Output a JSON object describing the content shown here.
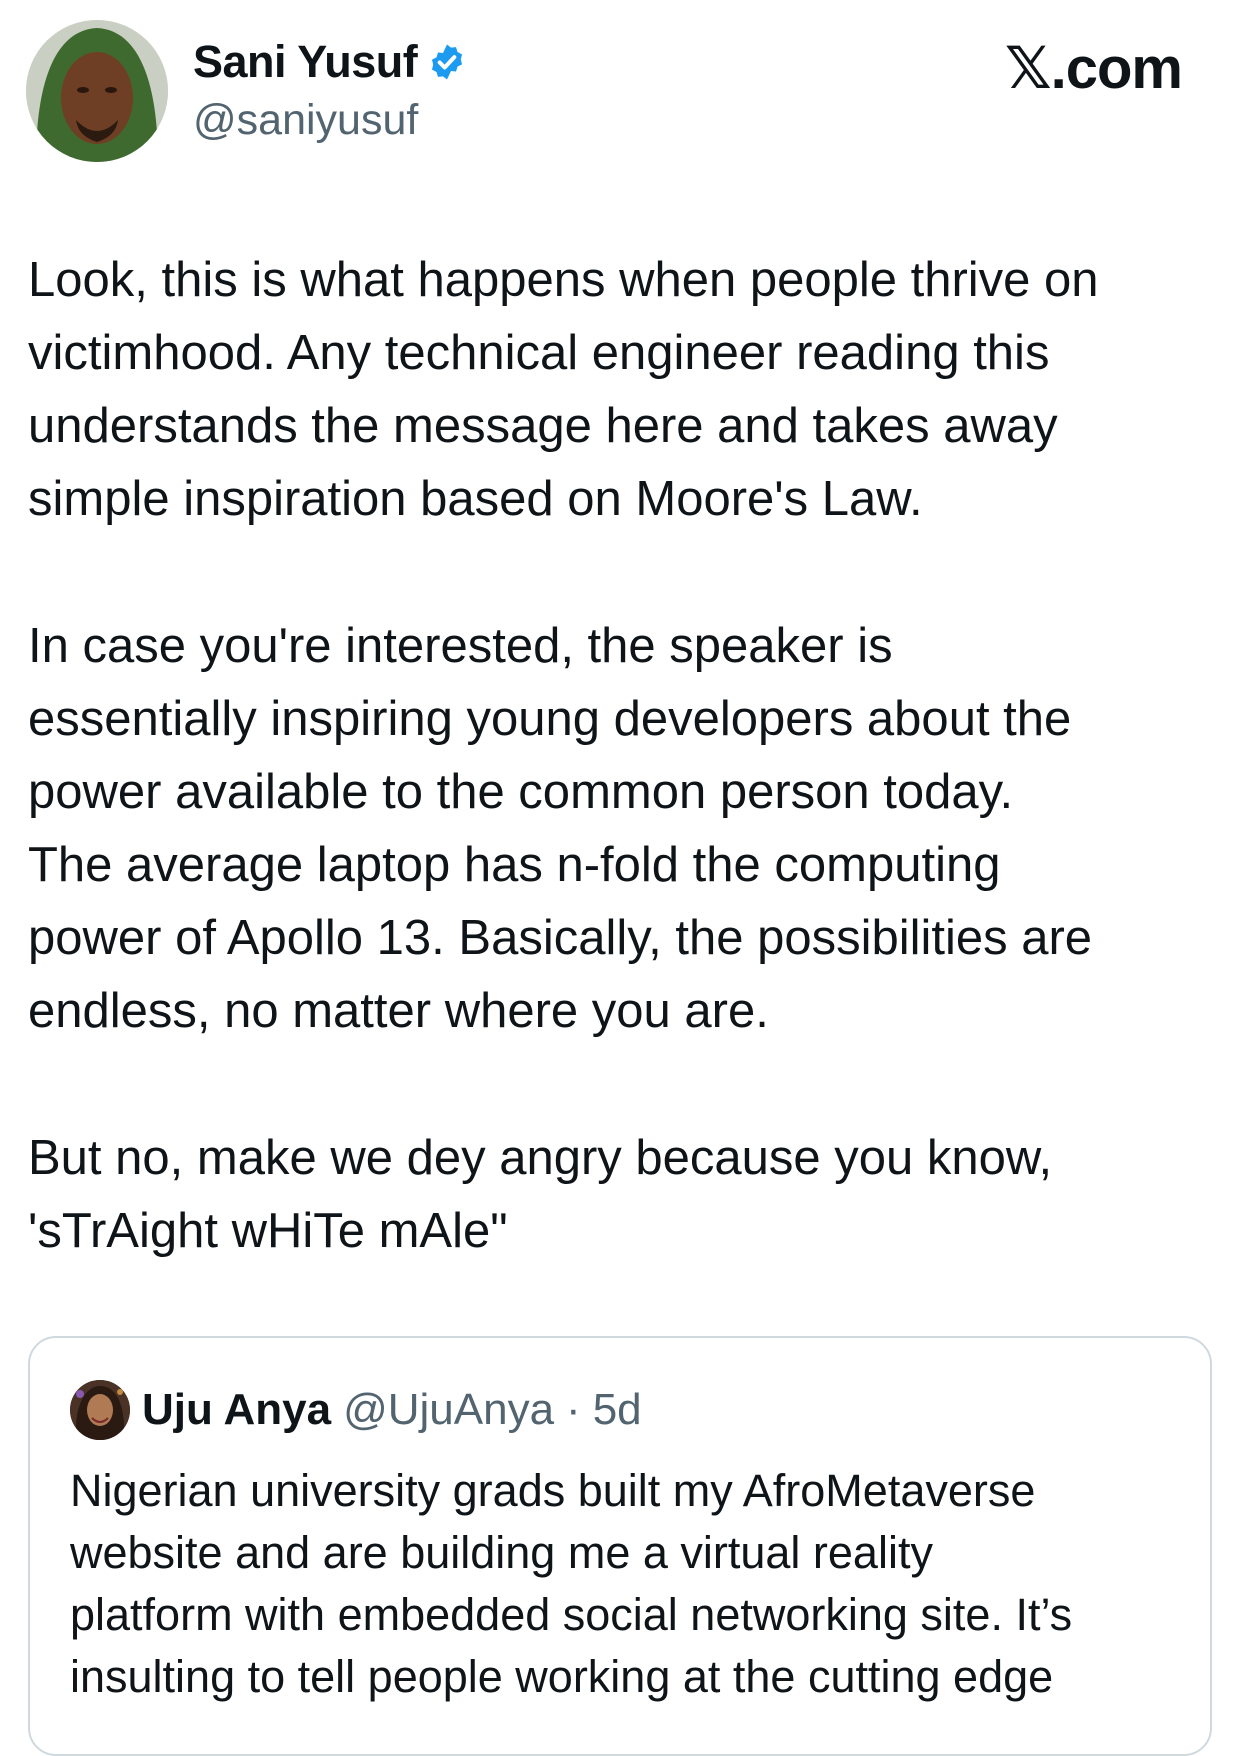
{
  "author": {
    "name": "Sani Yusuf",
    "handle": "@saniyusuf",
    "verified": true,
    "avatar_icon": "profile-photo"
  },
  "brand": "𝕏.com",
  "tweet": {
    "paragraphs": [
      "Look, this is what happens when people thrive on\nvictimhood. Any technical engineer reading this\nunderstands the message here and takes away\nsimple inspiration based on Moore's Law.",
      "In case you're interested, the speaker is\nessentially inspiring young developers about the\npower available to the common person today.\nThe average laptop has n-fold the computing\npower of Apollo 13. Basically, the possibilities are\nendless, no matter where you are.",
      "But no, make we dey angry because you know,\n'sTrAight wHiTe mAle\""
    ]
  },
  "quoted_tweet": {
    "name": "Uju Anya",
    "handle": "@UjuAnya",
    "separator": "·",
    "time": "5d",
    "text": "Nigerian university grads built my AfroMetaverse\nwebsite and are building me a virtual reality\nplatform with embedded social networking site. It’s\ninsulting to tell people working at the cutting edge"
  },
  "colors": {
    "text": "#0f1419",
    "secondary": "#536471",
    "verified_blue": "#1d9bf0",
    "border": "#cfd9de"
  }
}
